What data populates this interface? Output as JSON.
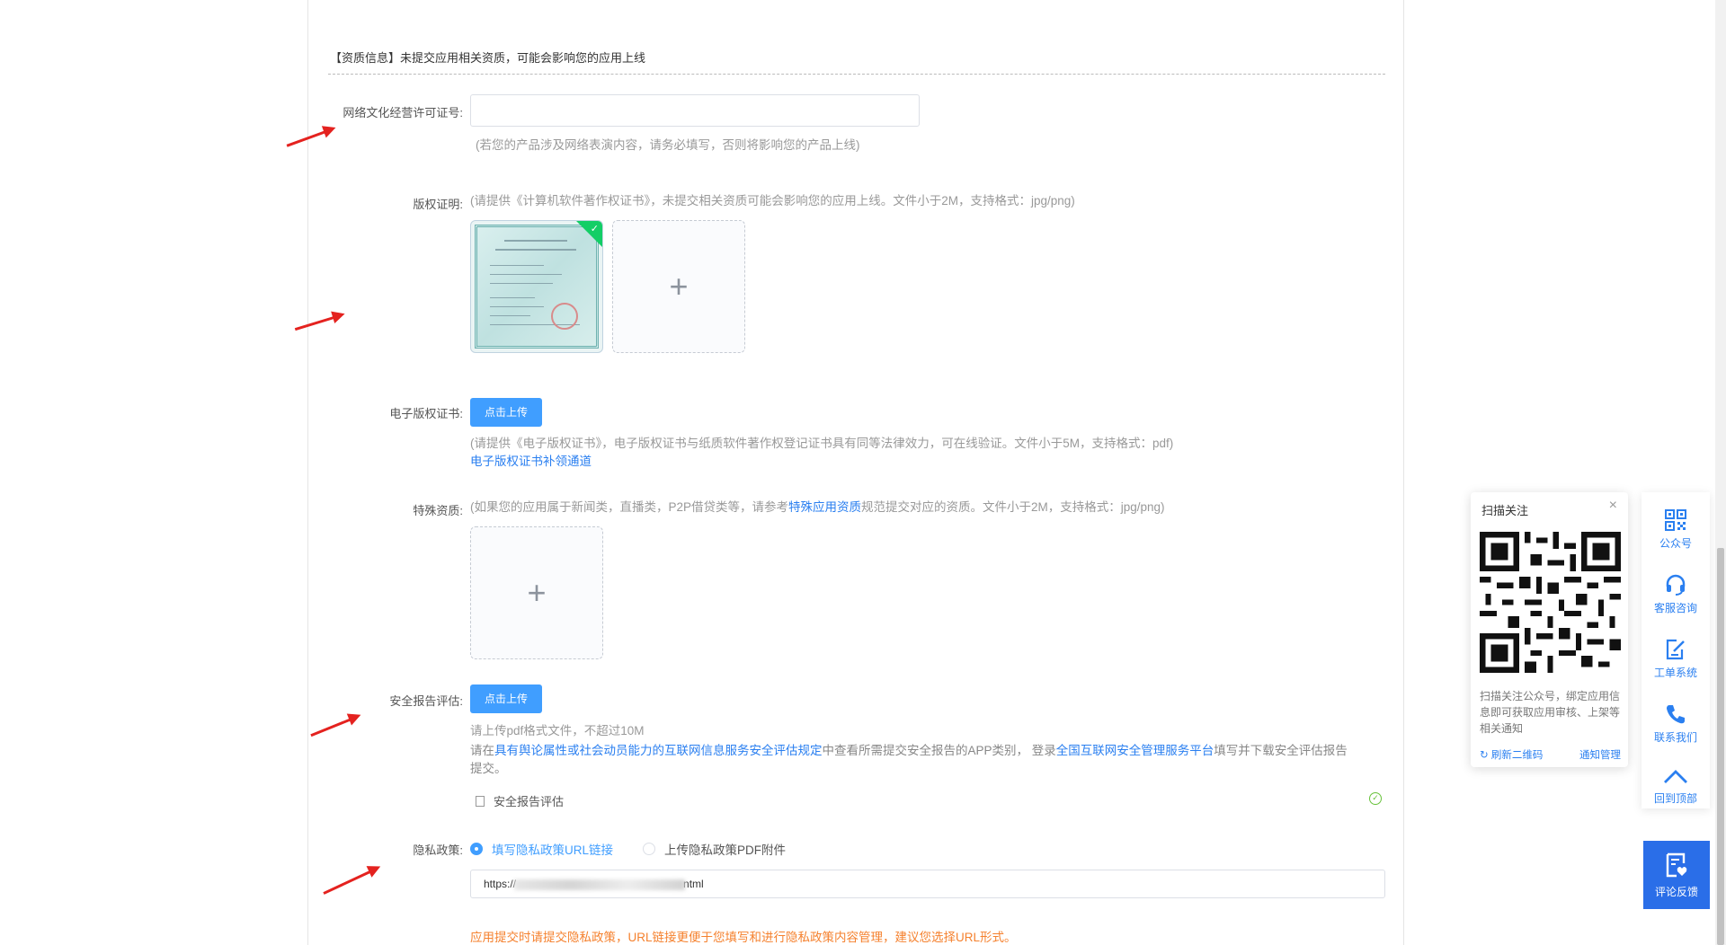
{
  "section": {
    "title": "【资质信息】未提交应用相关资质，可能会影响您的应用上线"
  },
  "license": {
    "label": "网络文化经营许可证号:",
    "value": "",
    "hint": "(若您的产品涉及网络表演内容，请务必填写，否则将影响您的产品上线)"
  },
  "copyright": {
    "label": "版权证明:",
    "hint": "(请提供《计算机软件著作权证书》，未提交相关资质可能会影响您的应用上线。文件小于2M，支持格式：jpg/png)",
    "upload_plus": "+"
  },
  "ecopyright": {
    "label": "电子版权证书:",
    "button": "点击上传",
    "hint": "(请提供《电子版权证书》，电子版权证书与纸质软件著作权登记证书具有同等法律效力，可在线验证。文件小于5M，支持格式：pdf)",
    "link": "电子版权证书补领通道"
  },
  "special": {
    "label": "特殊资质:",
    "hint_before": "(如果您的应用属于新闻类，直播类，P2P借贷类等，请参考",
    "hint_link": "特殊应用资质",
    "hint_after": "规范提交对应的资质。文件小于2M，支持格式：jpg/png)",
    "upload_plus": "+"
  },
  "security": {
    "label": "安全报告评估:",
    "button": "点击上传",
    "hint1": "请上传pdf格式文件，不超过10M",
    "hint2_before": "请在",
    "hint2_link1": "具有舆论属性或社会动员能力的互联网信息服务安全评估规定",
    "hint2_mid": "中查看所需提交安全报告的APP类别，  登录",
    "hint2_link2": "全国互联网安全管理服务平台",
    "hint2_after": "填写并下载安全评估报告",
    "hint2_wrap": "提交。",
    "file_name": "安全报告评估"
  },
  "privacy": {
    "label": "隐私政策:",
    "option_url": "填写隐私政策URL链接",
    "option_pdf": "上传隐私政策PDF附件",
    "url_prefix": "https://",
    "url_suffix": "ntml",
    "warning": "应用提交时请提交隐私政策，URL链接更便于您填写和进行隐私政策内容管理，建议您选择URL形式。"
  },
  "qr_panel": {
    "title": "扫描关注",
    "close": "×",
    "desc": "扫描关注公众号，绑定应用信息即可获取应用审核、上架等相关通知",
    "refresh": "刷新二维码",
    "notify": "通知管理"
  },
  "sidebar": {
    "items": [
      {
        "label": "公众号",
        "icon": "qrcode-icon"
      },
      {
        "label": "客服咨询",
        "icon": "headset-icon"
      },
      {
        "label": "工单系统",
        "icon": "edit-icon"
      },
      {
        "label": "联系我们",
        "icon": "phone-icon"
      },
      {
        "label": "回到顶部",
        "icon": "arrow-up-icon"
      }
    ],
    "feedback": "评论反馈"
  },
  "colors": {
    "primary": "#409eff",
    "link": "#2a7ff0",
    "warning": "#f5812e",
    "success": "#67c23a",
    "annotation_arrow": "#e4221f"
  }
}
